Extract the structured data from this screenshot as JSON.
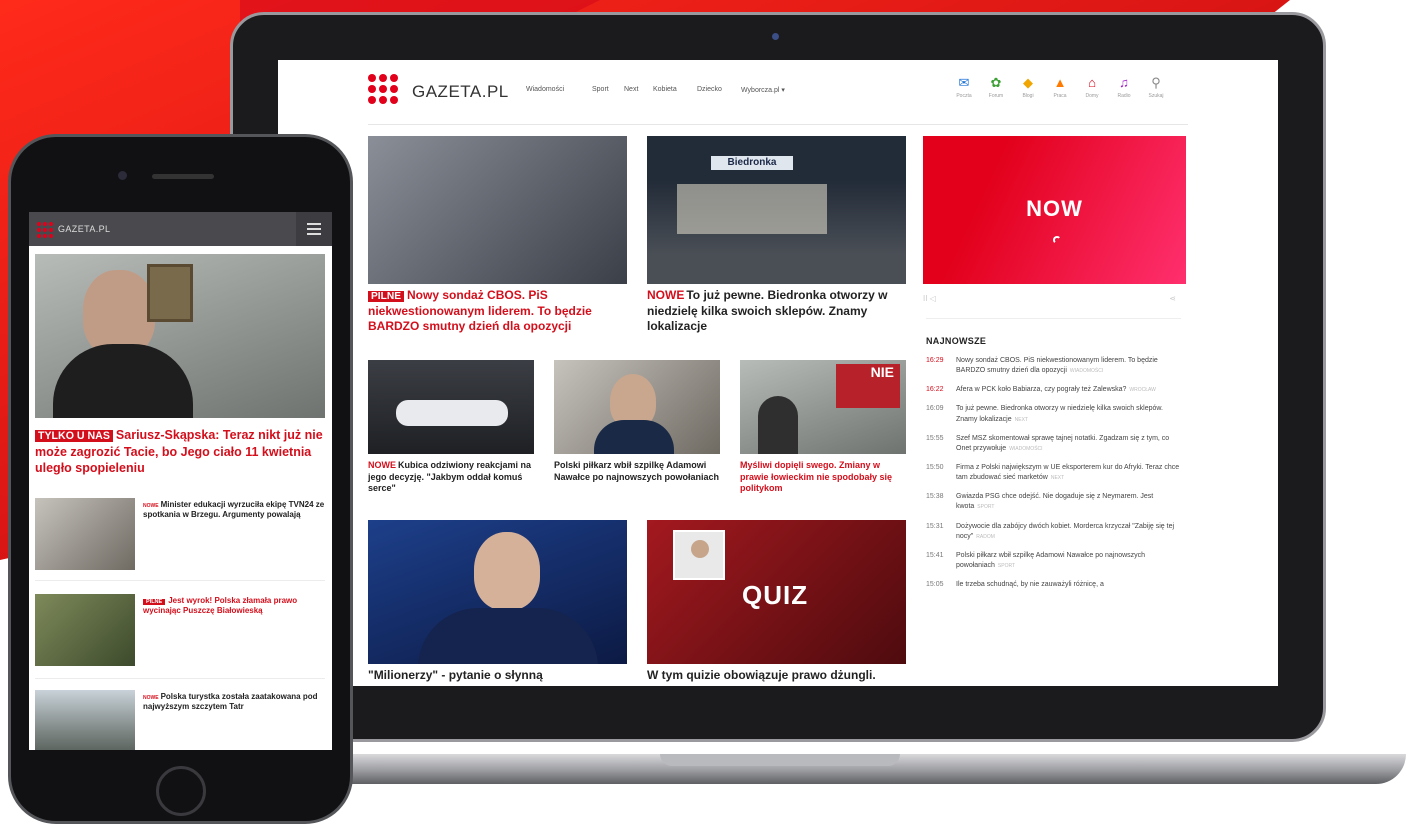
{
  "laptop": {
    "brand": "GAZETA.PL",
    "nav": [
      "Wiadomości",
      "Sport",
      "Next",
      "Kobieta",
      "Dziecko",
      "Wyborcza.pl ▾"
    ],
    "services": [
      {
        "icon": "✉",
        "label": "Poczta",
        "color": "#1f73d4"
      },
      {
        "icon": "✿",
        "label": "Forum",
        "color": "#3ea037"
      },
      {
        "icon": "◆",
        "label": "Blogi",
        "color": "#f0a500"
      },
      {
        "icon": "▲",
        "label": "Praca",
        "color": "#ff7a00"
      },
      {
        "icon": "⌂",
        "label": "Domy",
        "color": "#e2001a"
      },
      {
        "icon": "♫",
        "label": "Radio",
        "color": "#a020c8"
      },
      {
        "icon": "⚲",
        "label": "Szukaj",
        "color": "#888888"
      }
    ],
    "articles": {
      "a1": {
        "tag": "PILNE",
        "text": "Nowy sondaż CBOS. PiS niekwestionowanym liderem. To będzie BARDZO smutny dzień dla opozycji"
      },
      "a2": {
        "tag": "NOWE",
        "text": "To już pewne. Biedronka otworzy w niedzielę kilka swoich sklepów. Znamy lokalizacje"
      },
      "a3": {
        "tag": "NOWE",
        "text": "Kubica odziwiony reakcjami na jego decyzję. \"Jakbym oddał komuś serce\""
      },
      "a4": {
        "tag": "",
        "text": "Polski piłkarz wbił szpilkę Adamowi Nawałce po najnowszych powołaniach"
      },
      "a5": {
        "tag": "",
        "text": "Myśliwi dopięli swego. Zmiany w prawie łowieckim nie spodobały się politykom"
      },
      "a6": {
        "tag": "",
        "text": "\"Milionerzy\" - pytanie o słynną"
      },
      "a7": {
        "tag": "",
        "text": "W tym quizie obowiązuje prawo dżungli."
      }
    },
    "store_sign": "Biedronka",
    "protest_sign": "NIE",
    "quiz": "QUIZ",
    "now": "NOW",
    "player_controls": "II ◁",
    "player_share": "⋖",
    "latest_title": "NAJNOWSZE",
    "latest": [
      {
        "time": "16:29",
        "text": "Nowy sondaż CBOS. PiS niekwestionowanym liderem. To będzie BARDZO smutny dzień dla opozycji",
        "cat": "Wiadomości",
        "highlight": true
      },
      {
        "time": "16:22",
        "text": "Afera w PCK koło Babiarza, czy pograły też Zalewska?",
        "cat": "Wrocław",
        "highlight": true
      },
      {
        "time": "16:09",
        "text": "To już pewne. Biedronka otworzy w niedzielę kilka swoich sklepów. Znamy lokalizacje",
        "cat": "Next",
        "highlight": false
      },
      {
        "time": "15:55",
        "text": "Szef MSZ skomentował sprawę tajnej notatki. Zgadzam się z tym, co Onet przywołuje",
        "cat": "Wiadomości",
        "highlight": false
      },
      {
        "time": "15:50",
        "text": "Firma z Polski największym w UE eksporterem kur do Afryki. Teraz chce tam zbudować sieć marketów",
        "cat": "Next",
        "highlight": false
      },
      {
        "time": "15:38",
        "text": "Gwiazda PSG chce odejść. Nie dogaduje się z Neymarem. Jest kwota",
        "cat": "Sport",
        "highlight": false
      },
      {
        "time": "15:31",
        "text": "Dożywocie dla zabójcy dwóch kobiet. Morderca krzyczał \"Zabiję się tej nocy\"",
        "cat": "Radom",
        "highlight": false
      },
      {
        "time": "15:41",
        "text": "Polski piłkarz wbił szpilkę Adamowi Nawałce po najnowszych powołaniach",
        "cat": "Sport",
        "highlight": false
      },
      {
        "time": "15:05",
        "text": "Ile trzeba schudnąć, by nie zauważyli różnicę, a",
        "cat": "",
        "highlight": false
      }
    ]
  },
  "phone": {
    "brand": "GAZETA.PL",
    "hero": {
      "tag": "TYLKO U NAS",
      "text": "Sariusz-Skąpska: Teraz nikt już nie może zagrozić Tacie, bo Jego ciało 11 kwietnia uległo spopieleniu"
    },
    "items": [
      {
        "tag": "NOWE",
        "text": "Minister edukacji wyrzuciła ekipę TVN24 ze spotkania w Brzegu. Argumenty powalają"
      },
      {
        "tag": "PILNE",
        "text": "Jest wyrok! Polska złamała prawo wycinając Puszczę Białowieską"
      },
      {
        "tag": "NOWE",
        "text": "Polska turystka została zaatakowana pod najwyższym szczytem Tatr"
      }
    ]
  },
  "colors": {
    "brand_red": "#e2001a",
    "headline_red": "#d40f1c"
  }
}
